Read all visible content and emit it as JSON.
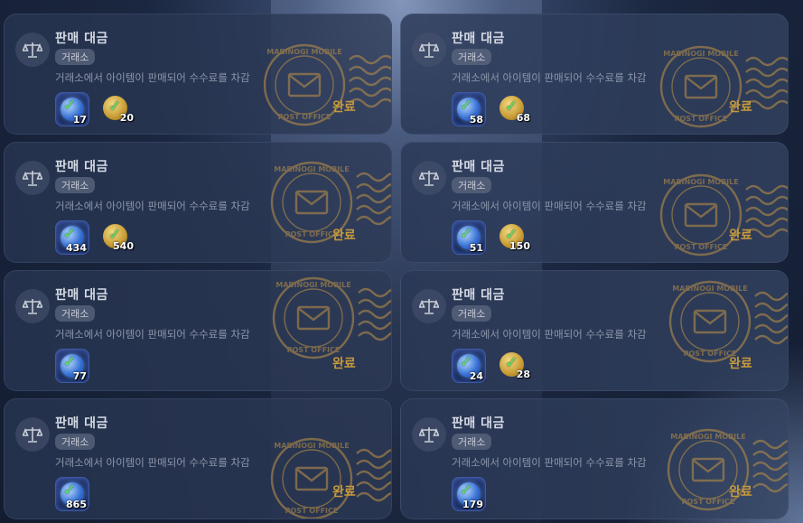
{
  "mail_list": {
    "items": [
      {
        "title": "판매 대금",
        "tag": "거래소",
        "description": "거래소에서 아이템이 판매되어 수수료를 차감",
        "gem_qty": "17",
        "gold_qty": "20",
        "status": "완료"
      },
      {
        "title": "판매 대금",
        "tag": "거래소",
        "description": "거래소에서 아이템이 판매되어 수수료를 차감",
        "gem_qty": "58",
        "gold_qty": "68",
        "status": "완료"
      },
      {
        "title": "판매 대금",
        "tag": "거래소",
        "description": "거래소에서 아이템이 판매되어 수수료를 차감",
        "gem_qty": "434",
        "gold_qty": "540",
        "status": "완료"
      },
      {
        "title": "판매 대금",
        "tag": "거래소",
        "description": "거래소에서 아이템이 판매되어 수수료를 차감",
        "gem_qty": "51",
        "gold_qty": "150",
        "status": "완료"
      },
      {
        "title": "판매 대금",
        "tag": "거래소",
        "description": "거래소에서 아이템이 판매되어 수수료를 차감",
        "gem_qty": "77",
        "gold_qty": null,
        "status": "완료"
      },
      {
        "title": "판매 대금",
        "tag": "거래소",
        "description": "거래소에서 아이템이 판매되어 수수료를 차감",
        "gem_qty": "24",
        "gold_qty": "28",
        "status": "완료"
      },
      {
        "title": "판매 대금",
        "tag": "거래소",
        "description": "거래소에서 아이템이 판매되어 수수료를 차감",
        "gem_qty": "865",
        "gold_qty": null,
        "status": "완료"
      },
      {
        "title": "판매 대금",
        "tag": "거래소",
        "description": "거래소에서 아이템이 판매되어 수수료를 차감",
        "gem_qty": "179",
        "gold_qty": null,
        "status": "완료"
      }
    ]
  },
  "stamp": {
    "top_text": "MABINOGI MOBILE",
    "bottom_text": "POST OFFICE",
    "color": "#b08a4a"
  },
  "icons": {
    "category": "scale-icon",
    "reward_gem": "blue-gem-icon",
    "reward_gold": "gold-coin-icon",
    "claimed": "check-icon",
    "stamp": "envelope-icon"
  }
}
